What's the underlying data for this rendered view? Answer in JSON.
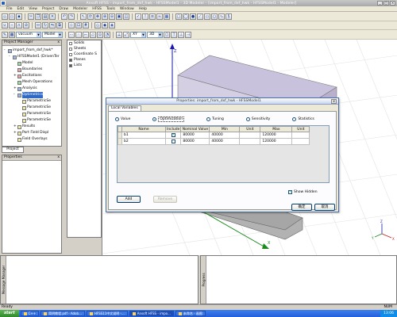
{
  "titlebar": {
    "title": "Ansoft HFSS - import_from_dxf_hwk - HFSSModel1 - 3D Modeler - [import_from_dxf_hwk - HFSSModel1 - Modeler]"
  },
  "menubar": {
    "items": [
      "File",
      "Edit",
      "View",
      "Project",
      "Draw",
      "Modeler",
      "HFSS",
      "Tools",
      "Window",
      "Help"
    ]
  },
  "toolbar": {
    "material_combo": "vacuum",
    "model_combo": "Model",
    "plane_combo": "XY",
    "dim_combo": "3D"
  },
  "project_manager": {
    "title": "Project Manager",
    "close": "x",
    "tree": [
      {
        "label": "import_from_dxf_hwk*",
        "indent": 0,
        "exp": "-",
        "icon": "blue"
      },
      {
        "label": "HFSSModel1 (DrivenTer",
        "indent": 1,
        "exp": "-",
        "icon": "blue"
      },
      {
        "label": "Model",
        "indent": 2,
        "exp": "",
        "icon": "grn"
      },
      {
        "label": "Boundaries",
        "indent": 2,
        "exp": "",
        "icon": "red"
      },
      {
        "label": "Excitations",
        "indent": 2,
        "exp": "+",
        "icon": "red"
      },
      {
        "label": "Mesh Operations",
        "indent": 2,
        "exp": "",
        "icon": "grn"
      },
      {
        "label": "Analysis",
        "indent": 2,
        "exp": "+",
        "icon": "blue"
      },
      {
        "label": "Optimetrics",
        "indent": 2,
        "exp": "-",
        "icon": "blue",
        "selected": true
      },
      {
        "label": "ParametricSe",
        "indent": 3,
        "exp": "",
        "icon": "yellow"
      },
      {
        "label": "ParametricSe",
        "indent": 3,
        "exp": "",
        "icon": "yellow"
      },
      {
        "label": "ParametricSe",
        "indent": 3,
        "exp": "",
        "icon": "yellow"
      },
      {
        "label": "ParametricSe",
        "indent": 3,
        "exp": "",
        "icon": "yellow"
      },
      {
        "label": "Results",
        "indent": 2,
        "exp": "+",
        "icon": "yellow"
      },
      {
        "label": "Port Field Displ",
        "indent": 2,
        "exp": "+",
        "icon": "yellow"
      },
      {
        "label": "Field Overlays",
        "indent": 2,
        "exp": "",
        "icon": "yellow"
      }
    ],
    "tab_label": "Project"
  },
  "properties": {
    "title": "Properties",
    "close": "x"
  },
  "model_list": {
    "items": [
      "Solids",
      "Sheets",
      "Coordinate S",
      "Planes",
      "Lists"
    ]
  },
  "viewport": {
    "axis_y": "Y",
    "axis_z": "Z",
    "axis_x": "X"
  },
  "dialog": {
    "title": "Properties: import_from_dxf_hwk - HFSSModel1",
    "close": "x",
    "tab": "Local Variables",
    "radios": [
      {
        "label": "Value",
        "checked": false
      },
      {
        "label": "Optimization",
        "checked": true
      },
      {
        "label": "Tuning",
        "checked": false
      },
      {
        "label": "Sensitivity",
        "checked": false
      },
      {
        "label": "Statistics",
        "checked": false
      }
    ],
    "columns": [
      "Name",
      "Include",
      "Nominal Value",
      "Min",
      "Unit",
      "Max",
      "Unit"
    ],
    "rows": [
      {
        "name": "b1",
        "include": true,
        "nominal": "80000",
        "min": "40000",
        "unit": "",
        "max": "120000",
        "unit2": ""
      },
      {
        "name": "b2",
        "include": false,
        "nominal": "80000",
        "min": "40000",
        "unit": "",
        "max": "120000",
        "unit2": ""
      }
    ],
    "add_button": "Add",
    "remove_button": "Remove",
    "show_hidden": "Show Hidden",
    "ok_button": "确定",
    "cancel_button": "取消"
  },
  "message_panel": {
    "label": "Message Manager"
  },
  "progress_panel": {
    "label": "Progress"
  },
  "statusbar": {
    "text": "Ready",
    "num": "NUM"
  },
  "taskbar": {
    "start": "start",
    "tasks": [
      "C++",
      "简明教程.pdf - Adob...",
      "HFSS11中文说明 -...",
      "Ansoft HFSS - impo...",
      "未命名 - 画图"
    ],
    "clock": "13:06"
  }
}
